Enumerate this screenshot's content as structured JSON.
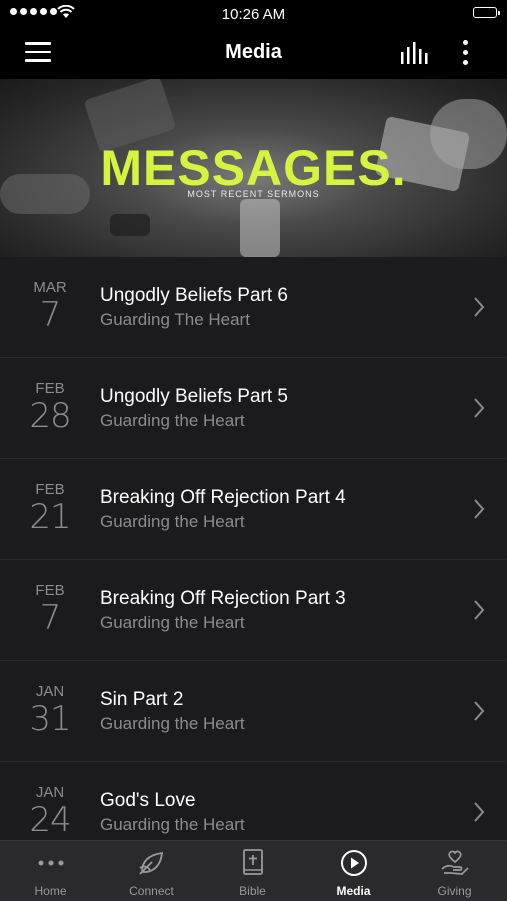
{
  "status": {
    "time": "10:26 AM"
  },
  "header": {
    "title": "Media"
  },
  "banner": {
    "headline": "MESSAGES.",
    "subtitle": "MOST RECENT SERMONS"
  },
  "messages": [
    {
      "month": "MAR",
      "day": "7",
      "title": "Ungodly Beliefs Part 6",
      "series": "Guarding The Heart"
    },
    {
      "month": "FEB",
      "day": "28",
      "title": "Ungodly Beliefs Part 5",
      "series": "Guarding the Heart"
    },
    {
      "month": "FEB",
      "day": "21",
      "title": "Breaking Off Rejection Part 4",
      "series": "Guarding the Heart"
    },
    {
      "month": "FEB",
      "day": "7",
      "title": "Breaking Off Rejection Part 3",
      "series": "Guarding the Heart"
    },
    {
      "month": "JAN",
      "day": "31",
      "title": "Sin Part 2",
      "series": "Guarding the Heart"
    },
    {
      "month": "JAN",
      "day": "24",
      "title": "God's Love",
      "series": "Guarding the Heart"
    }
  ],
  "tabs": [
    {
      "label": "Home",
      "icon": "more-dots-icon"
    },
    {
      "label": "Connect",
      "icon": "leaf-icon"
    },
    {
      "label": "Bible",
      "icon": "bible-icon"
    },
    {
      "label": "Media",
      "icon": "play-circle-icon",
      "active": true
    },
    {
      "label": "Giving",
      "icon": "heart-hand-icon"
    }
  ],
  "colors": {
    "accent": "#d4f43f",
    "background": "#1b1b1d",
    "tab_bar": "#2a2a2c"
  }
}
